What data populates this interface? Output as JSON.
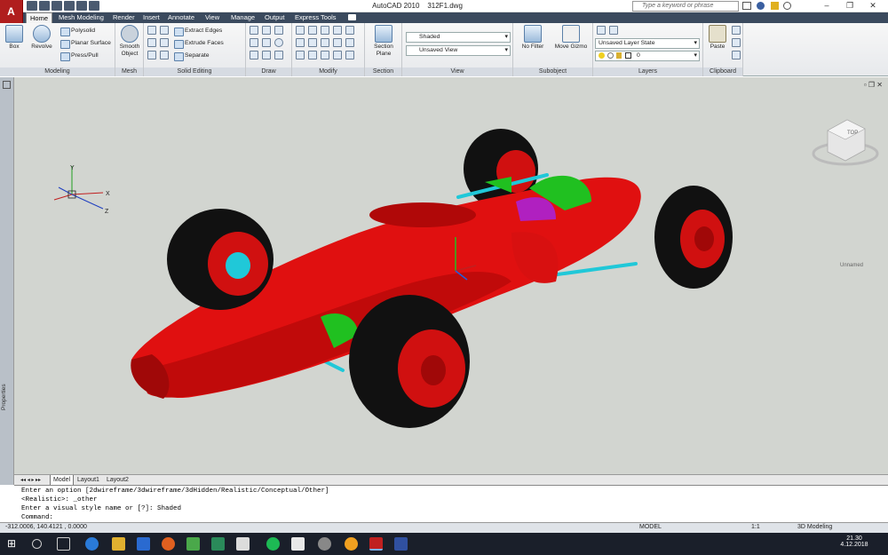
{
  "titlebar": {
    "app_icon": "A",
    "app_name": "AutoCAD 2010",
    "file_name": "312F1.dwg",
    "search_placeholder": "Type a keyword or phrase"
  },
  "tabs": [
    "Home",
    "Mesh Modeling",
    "Render",
    "Insert",
    "Annotate",
    "View",
    "Manage",
    "Output",
    "Express Tools"
  ],
  "ribbon": {
    "modeling": {
      "title": "Modeling",
      "box": "Box",
      "revolve": "Revolve",
      "polysolid": "Polysolid",
      "planar_surface": "Planar Surface",
      "press_pull": "Press/Pull"
    },
    "mesh": {
      "title": "Mesh",
      "smooth_object_1": "Smooth",
      "smooth_object_2": "Object"
    },
    "solid_editing": {
      "title": "Solid Editing",
      "extract_edges": "Extract Edges",
      "extrude_faces": "Extrude Faces",
      "separate": "Separate"
    },
    "draw": {
      "title": "Draw"
    },
    "modify": {
      "title": "Modify"
    },
    "section": {
      "title": "Section",
      "section_plane_1": "Section",
      "section_plane_2": "Plane"
    },
    "view": {
      "title": "View",
      "visual_style": "Shaded",
      "saved_view": "Unsaved View"
    },
    "subobject": {
      "title": "Subobject",
      "no_filter": "No Filter",
      "move_gizmo": "Move Gizmo"
    },
    "layers": {
      "title": "Layers",
      "layer_state": "Unsaved Layer State",
      "current_layer": "0"
    },
    "clipboard": {
      "title": "Clipboard",
      "paste": "Paste"
    }
  },
  "leftbar": {
    "properties": "Properties"
  },
  "viewport": {
    "viewcube_top": "TOP",
    "named_view": "Unnamed",
    "ucs_x": "X",
    "ucs_y": "Y",
    "ucs_z": "Z"
  },
  "layout_tabs": [
    "Model",
    "Layout1",
    "Layout2"
  ],
  "command": {
    "lines": [
      "Enter an option [2dwireframe/3dwireframe/3dHidden/Realistic/Conceptual/Other]",
      "<Realistic>: _other",
      "Enter a visual style name or [?]: Shaded"
    ],
    "prompt": "Command:"
  },
  "status": {
    "coords": "-312.0006, 140.4121 , 0.0000",
    "model": "MODEL",
    "scale": "1:1",
    "workspace": "3D Modeling"
  },
  "taskbar": {
    "time": "21.30",
    "date": "4.12.2018"
  },
  "colors": {
    "tab_bar": "#3b4a5e",
    "viewport_bg": "#d2d5d0",
    "car_body": "#e01010",
    "tire": "#111111",
    "suspension": "#20c8d8",
    "engine_green": "#20c020",
    "engine_magenta": "#b020c0"
  }
}
